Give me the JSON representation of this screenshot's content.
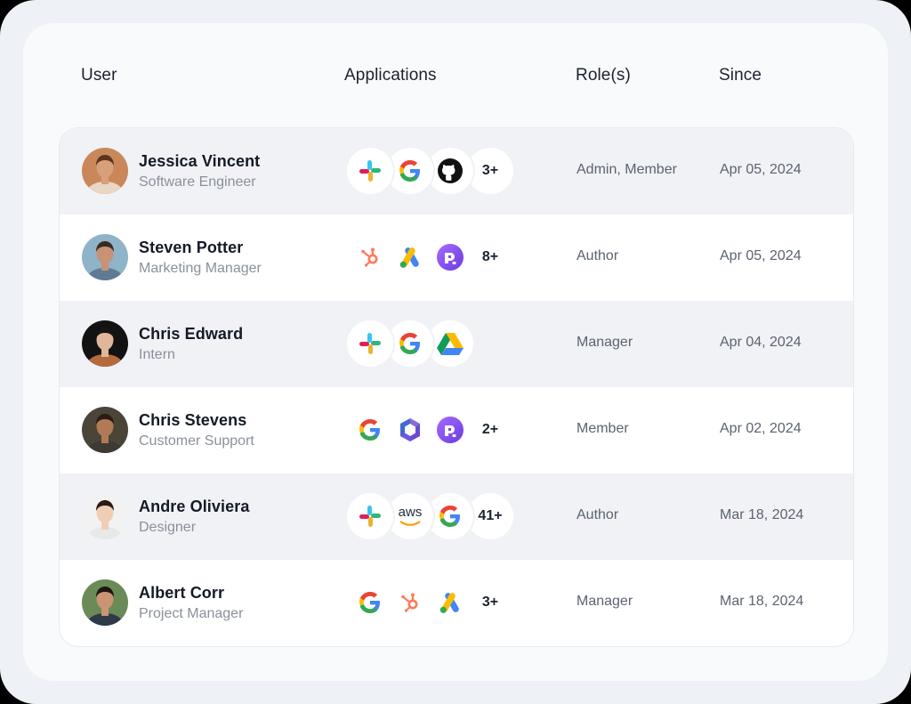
{
  "columns": {
    "user": "User",
    "applications": "Applications",
    "roles": "Role(s)",
    "since": "Since"
  },
  "rows": [
    {
      "name": "Jessica Vincent",
      "title": "Software Engineer",
      "avatar": {
        "skin": "#d8a07a",
        "hair": "#5a3520",
        "bg": "#c9875a",
        "shirt": "#e9d6c4"
      },
      "apps": [
        "slack-icon",
        "google-icon",
        "github-icon"
      ],
      "more": "3+",
      "roles": "Admin, Member",
      "since": "Apr 05, 2024"
    },
    {
      "name": "Steven Potter",
      "title": "Marketing Manager",
      "avatar": {
        "skin": "#c89277",
        "hair": "#3b2a20",
        "bg": "#8fb3c8",
        "shirt": "#5f7a94"
      },
      "apps": [
        "hubspot-icon",
        "google-ads-icon",
        "wordpress-icon"
      ],
      "more": "8+",
      "roles": "Author",
      "since": "Apr 05, 2024"
    },
    {
      "name": "Chris Edward",
      "title": "Intern",
      "avatar": {
        "skin": "#e0b79a",
        "hair": "#1a1410",
        "bg": "#121212",
        "shirt": "#b56a3e"
      },
      "apps": [
        "slack-icon",
        "google-icon",
        "google-drive-icon"
      ],
      "more": "",
      "roles": "Manager",
      "since": "Apr 04, 2024"
    },
    {
      "name": "Chris Stevens",
      "title": "Customer Support",
      "avatar": {
        "skin": "#b07a55",
        "hair": "#2a1c12",
        "bg": "#4a4538",
        "shirt": "#3d3a33"
      },
      "apps": [
        "google-icon",
        "microsoft-365-icon",
        "wordpress-icon"
      ],
      "more": "2+",
      "roles": "Member",
      "since": "Apr 02, 2024"
    },
    {
      "name": "Andre Oliviera",
      "title": "Designer",
      "avatar": {
        "skin": "#f0cdb5",
        "hair": "#2a1a12",
        "bg": "#f2f2f2",
        "shirt": "#e8e8e8"
      },
      "apps": [
        "slack-icon",
        "aws-icon",
        "google-icon"
      ],
      "more": "41+",
      "roles": "Author",
      "since": "Mar 18, 2024"
    },
    {
      "name": "Albert Corr",
      "title": "Project Manager",
      "avatar": {
        "skin": "#c99574",
        "hair": "#1e1610",
        "bg": "#6a8a58",
        "shirt": "#2e3a48"
      },
      "apps": [
        "google-icon",
        "hubspot-icon",
        "google-ads-icon"
      ],
      "more": "3+",
      "roles": "Manager",
      "since": "Mar 18, 2024"
    }
  ],
  "aws_label": "aws"
}
